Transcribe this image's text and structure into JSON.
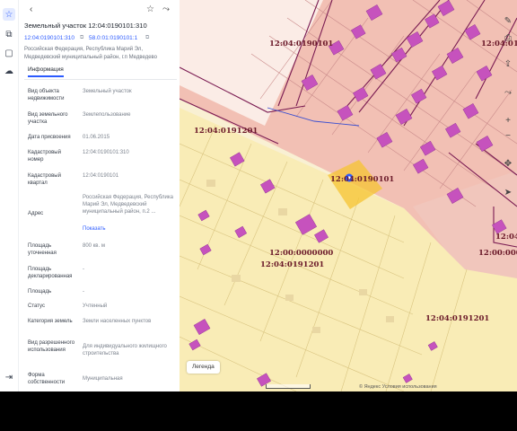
{
  "panel": {
    "title": "Земельный участок 12:04:0190101:310",
    "cadastral_id": "12:04:0190101:310",
    "secondary_id": "58.0:01:0190101:1",
    "address_line": "Российская Федерация, Республика Марий Эл, Медведевский муниципальный район, г.п Медведево",
    "tab_info": "Информация",
    "props": [
      {
        "label": "Вид объекта недвижимости",
        "value": "Земельный участок"
      },
      {
        "label": "Вид земельного участка",
        "value": "Землепользование"
      },
      {
        "label": "Дата присвоения",
        "value": "01.06.2015"
      },
      {
        "label": "Кадастровый номер",
        "value": "12:04:0190101:310"
      },
      {
        "label": "Кадастровый квартал",
        "value": "12:04:0190101"
      },
      {
        "label": "Адрес",
        "value": "Российская Федерация, Республика Марий Эл, Медведевский муниципальный район, п.2 ..."
      },
      {
        "label": "Площадь уточненная",
        "value": "800 кв. м"
      },
      {
        "label": "Площадь декларированная",
        "value": "-"
      },
      {
        "label": "Площадь",
        "value": "-"
      },
      {
        "label": "Статус",
        "value": "Учтенный"
      },
      {
        "label": "Категория земель",
        "value": "Земли населенных пунктов"
      },
      {
        "label": "Вид разрешенного использования",
        "value": "Для индивидуального жилищного строительства"
      },
      {
        "label": "Форма собственности",
        "value": "Муниципальная"
      }
    ],
    "address_more": "Показать"
  },
  "map": {
    "labels": [
      "12:04:0190101",
      "12:04:0190101",
      "12:04:0191201",
      "12:00:0000000",
      "12:04:0191201",
      "12:04:0191201",
      "12:00:0000000",
      "12:04:0191201",
      "12:04:0190101"
    ],
    "legend_button": "Легенда",
    "attribution": "© Яндекс  Условия использования"
  },
  "icons": {
    "rail": [
      "star-icon",
      "layers-icon",
      "square-icon",
      "cloud-icon",
      "logout-icon"
    ],
    "map": [
      "pencil-icon",
      "print-icon",
      "upload-icon",
      "share-icon",
      "zoom-in-icon",
      "zoom-out-icon",
      "move-icon",
      "locate-icon"
    ]
  },
  "colors": {
    "accent": "#2c5bff",
    "parcel_fill": "#f9ecb6",
    "quarter_red": "#f2c0b4",
    "building": "#c652bd",
    "boundary": "#7a1b52"
  }
}
